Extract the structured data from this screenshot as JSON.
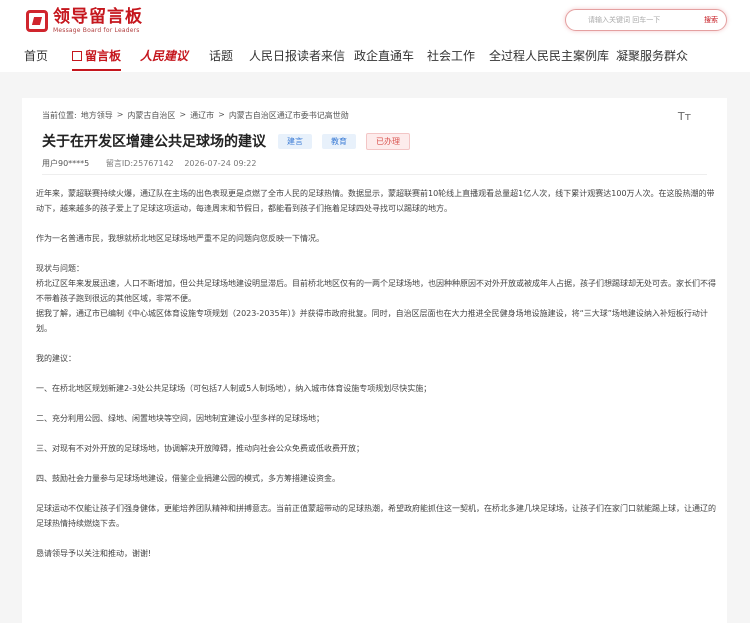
{
  "logo": {
    "cn": "领导留言板",
    "en": "Message Board for Leaders"
  },
  "search": {
    "placeholder": "请输入关键词 回车一下",
    "button": "搜索"
  },
  "nav": [
    "首页",
    "留言板",
    "人民建议",
    "话题",
    "人民日报读者来信",
    "政企直通车",
    "社会工作",
    "全过程人民民主案例库",
    "凝聚服务群众"
  ],
  "breadcrumb": [
    "当前位置:",
    "地方领导",
    ">",
    "内蒙古自治区",
    ">",
    "通辽市",
    ">",
    "内蒙古自治区通辽市委书记高世勋"
  ],
  "font_toggle": "Tт",
  "post": {
    "title": "关于在开发区增建公共足球场的建议",
    "tags": [
      "建言",
      "教育",
      "已办理"
    ],
    "user": "用户90****5",
    "message_id": "留言ID:25767142",
    "date": "2026-07-24 09:22"
  },
  "content": [
    "近年来，蒙超联赛持续火爆，通辽队在主场的出色表现更是点燃了全市人民的足球热情。数据显示，蒙超联赛前10轮线上直播观看总量超1亿人次，线下累计观赛达100万人次。在这股热潮的带动下，越来越多的孩子爱上了足球这项运动，每逢周末和节假日，都能看到孩子们拖着足球四处寻找可以踢球的地方。",
    "",
    "作为一名普通市民，我想就桥北地区足球场地严重不足的问题向您反映一下情况。",
    "",
    "现状与问题：",
    "桥北辽区年来发展迅速，人口不断增加，但公共足球场地建设明显滞后。目前桥北地区仅有的一两个足球场地，也因种种原因不对外开放或被成年人占据，孩子们想踢球却无处可去。家长们不得不带着孩子跑到很远的其他区域，非常不便。",
    "据我了解，通辽市已编制《中心城区体育设施专项规划（2023-2035年）》并获得市政府批复。同时，自治区层面也在大力推进全民健身场地设施建设，将“三大球”场地建设纳入补短板行动计划。",
    "",
    "我的建议：",
    "",
    "一、在桥北地区规划新建2-3处公共足球场（可包括7人制或5人制场地），纳入城市体育设施专项规划尽快实施；",
    "",
    "二、充分利用公园、绿地、闲置地块等空间，因地制宜建设小型多样的足球场地；",
    "",
    "三、对现有不对外开放的足球场地，协调解决开放障碍，推动向社会公众免费或低收费开放；",
    "",
    "四、鼓励社会力量参与足球场地建设，借鉴企业捐建公园的模式，多方筹措建设资金。",
    "",
    "足球运动不仅能让孩子们强身健体，更能培养团队精神和拼搏意志。当前正值蒙超带动的足球热潮，希望政府能抓住这一契机，在桥北多建几块足球场，让孩子们在家门口就能踢上球，让通辽的足球热情持续燃烧下去。",
    "",
    "恳请领导予以关注和推动，谢谢!"
  ],
  "colors": {
    "brand_red": "#c5161d",
    "tag_blue": "#3a7bd5",
    "tag_red": "#d9534f"
  }
}
